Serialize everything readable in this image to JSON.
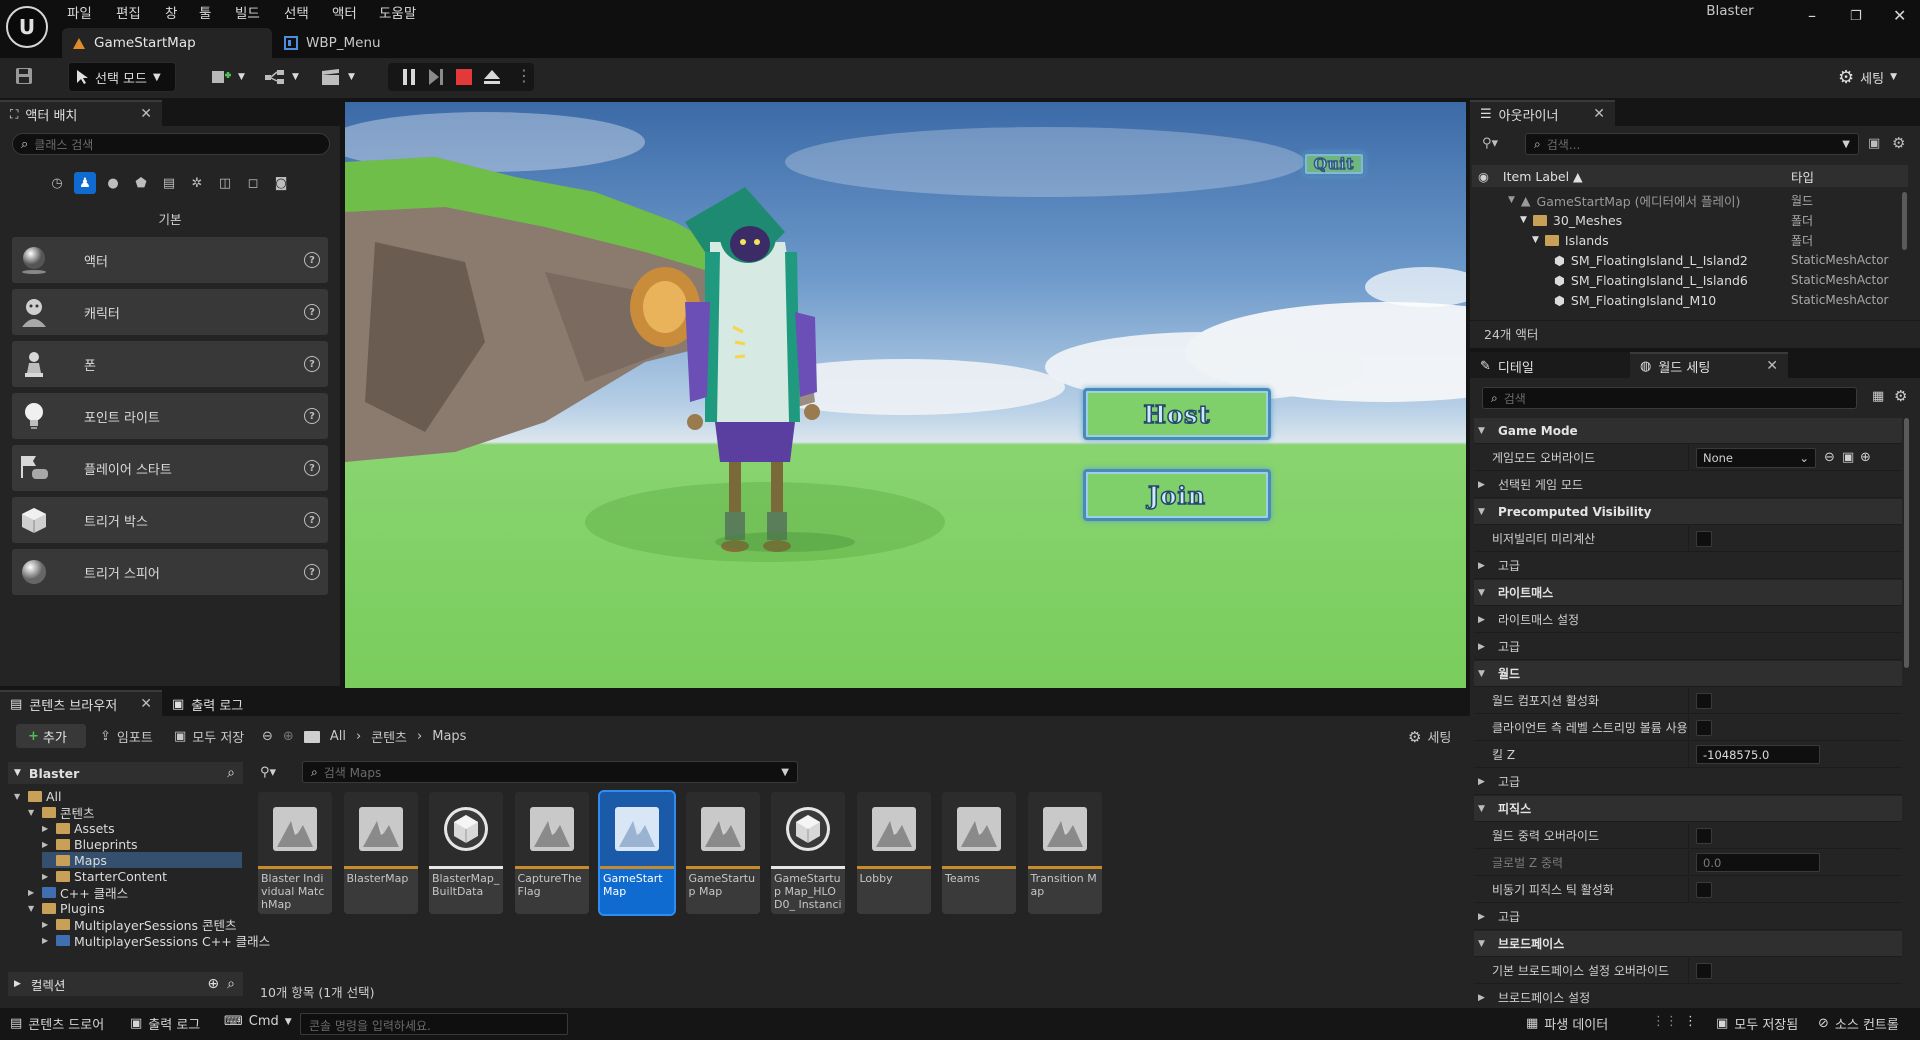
{
  "app": {
    "logo": "U",
    "project": "Blaster",
    "min": "–",
    "max": "❐",
    "close": "✕"
  },
  "menu": [
    "파일",
    "편집",
    "창",
    "툴",
    "빌드",
    "선택",
    "액터",
    "도움말"
  ],
  "tabs": [
    {
      "label": "GameStartMap"
    },
    {
      "label": "WBP_Menu"
    }
  ],
  "toolbar": {
    "mode_label": "선택 모드",
    "settings_label": "세팅"
  },
  "place_actors": {
    "tab": "액터 배치",
    "search_placeholder": "클래스 검색",
    "category": "기본",
    "items": [
      "액터",
      "캐릭터",
      "폰",
      "포인트 라이트",
      "플레이어 스타트",
      "트리거 박스",
      "트리거 스피어"
    ]
  },
  "viewport": {
    "quit_label": "Quit",
    "host_label": "Host",
    "join_label": "Join"
  },
  "outliner": {
    "tab": "아웃라이너",
    "search_placeholder": "검색...",
    "col_label": "Item Label ▲",
    "col_type": "타입",
    "rows": [
      {
        "label": "GameStartMap (에디터에서 플레이)",
        "type": "월드"
      },
      {
        "label": "30_Meshes",
        "type": "폴더"
      },
      {
        "label": "Islands",
        "type": "폴더"
      },
      {
        "label": "SM_FloatingIsland_L_Island2",
        "type": "StaticMeshActor"
      },
      {
        "label": "SM_FloatingIsland_L_Island6",
        "type": "StaticMeshActor"
      },
      {
        "label": "SM_FloatingIsland_M10",
        "type": "StaticMeshActor"
      }
    ],
    "count": "24개 액터"
  },
  "details": {
    "tab_details": "디테일",
    "tab_world": "월드 세팅",
    "search_placeholder": "검색",
    "rows": [
      {
        "kind": "cat",
        "label": "Game Mode"
      },
      {
        "kind": "prop",
        "label": "게임모드 오버라이드",
        "value": "None",
        "ctrl": "select"
      },
      {
        "kind": "sub",
        "label": "선택된 게임 모드"
      },
      {
        "kind": "cat",
        "label": "Precomputed Visibility"
      },
      {
        "kind": "prop",
        "label": "비저빌리티 미리계산",
        "ctrl": "check"
      },
      {
        "kind": "sub",
        "label": "고급"
      },
      {
        "kind": "cat",
        "label": "라이트매스"
      },
      {
        "kind": "sub",
        "label": "라이트매스 설정"
      },
      {
        "kind": "sub",
        "label": "고급"
      },
      {
        "kind": "cat",
        "label": "월드"
      },
      {
        "kind": "prop",
        "label": "월드 컴포지션 활성화",
        "ctrl": "check"
      },
      {
        "kind": "prop",
        "label": "클라이언트 측 레벨 스트리밍 볼륨 사용",
        "ctrl": "check"
      },
      {
        "kind": "prop",
        "label": "킬 Z",
        "value": "-1048575.0",
        "ctrl": "num"
      },
      {
        "kind": "sub",
        "label": "고급"
      },
      {
        "kind": "cat",
        "label": "피직스"
      },
      {
        "kind": "prop",
        "label": "월드 중력 오버라이드",
        "ctrl": "check"
      },
      {
        "kind": "prop",
        "label": "글로벌 Z 중력",
        "value": "0.0",
        "ctrl": "num",
        "dim": true
      },
      {
        "kind": "prop",
        "label": "비동기 피직스 틱 활성화",
        "ctrl": "check"
      },
      {
        "kind": "sub",
        "label": "고급"
      },
      {
        "kind": "cat",
        "label": "브로드페이스"
      },
      {
        "kind": "prop",
        "label": "기본 브로드페이스 설정 오버라이드",
        "ctrl": "check"
      },
      {
        "kind": "sub",
        "label": "브로드페이스 설정"
      }
    ]
  },
  "content_browser": {
    "tab": "콘텐츠 브라우저",
    "tab_log": "출력 로그",
    "add": "추가",
    "import": "임포트",
    "save_all": "모두 저장",
    "crumbs": [
      "All",
      "콘텐츠",
      "Maps"
    ],
    "settings": "세팅",
    "root": "Blaster",
    "search_placeholder": "검색 Maps",
    "tree": [
      {
        "label": "All",
        "depth": 0,
        "open": true
      },
      {
        "label": "콘텐츠",
        "depth": 1,
        "open": true
      },
      {
        "label": "Assets",
        "depth": 2
      },
      {
        "label": "Blueprints",
        "depth": 2
      },
      {
        "label": "Maps",
        "depth": 2,
        "selected": true
      },
      {
        "label": "StarterContent",
        "depth": 2
      },
      {
        "label": "C++ 클래스",
        "depth": 1
      },
      {
        "label": "Plugins",
        "depth": 1,
        "open": true
      },
      {
        "label": "MultiplayerSessions 콘텐츠",
        "depth": 2
      },
      {
        "label": "MultiplayerSessions C++ 클래스",
        "depth": 2
      }
    ],
    "collections": "컬렉션",
    "assets": [
      {
        "label": "Blaster Individual MatchMap",
        "icon": "map"
      },
      {
        "label": "BlasterMap",
        "icon": "map"
      },
      {
        "label": "BlasterMap_ BuiltData",
        "icon": "data"
      },
      {
        "label": "CaptureThe Flag",
        "icon": "map"
      },
      {
        "label": "GameStart Map",
        "icon": "map",
        "selected": true
      },
      {
        "label": "GameStartup Map",
        "icon": "map"
      },
      {
        "label": "GameStartup Map_HLOD0_ Instancing",
        "icon": "data"
      },
      {
        "label": "Lobby",
        "icon": "map"
      },
      {
        "label": "Teams",
        "icon": "map"
      },
      {
        "label": "Transition Map",
        "icon": "map"
      }
    ],
    "count": "10개 항목 (1개 선택)"
  },
  "statusbar": {
    "drawer": "콘텐츠 드로어",
    "log": "출력 로그",
    "cmd": "Cmd",
    "cmd_placeholder": "콘솔 명령을 입력하세요.",
    "derived": "파생 데이터",
    "save_all": "모두 저장됨",
    "source": "소스 컨트롤"
  }
}
